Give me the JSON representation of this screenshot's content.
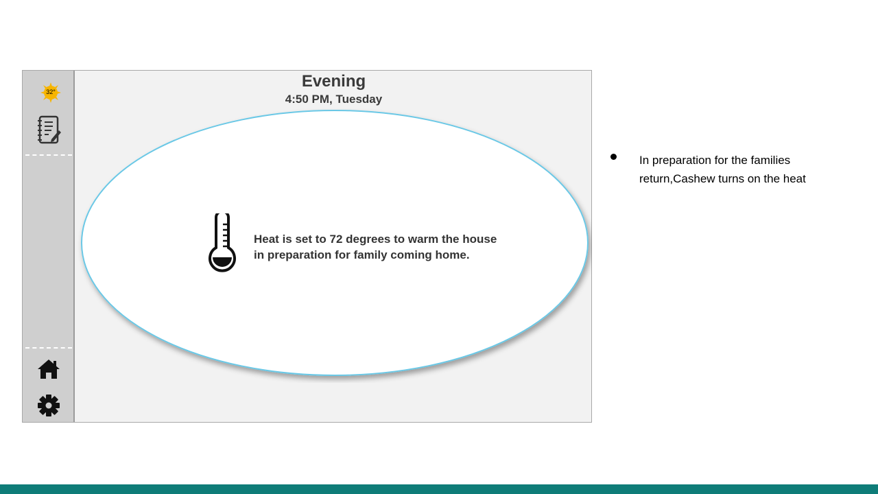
{
  "sidebar": {
    "weather": {
      "temperature": "32°",
      "icon": "sun-icon",
      "color": "#f7b500"
    },
    "items": [
      {
        "name": "notes",
        "icon": "notebook-icon"
      },
      {
        "name": "home",
        "icon": "home-icon"
      },
      {
        "name": "settings",
        "icon": "gear-icon"
      }
    ]
  },
  "header": {
    "period": "Evening",
    "datetime": "4:50 PM, Tuesday"
  },
  "notification": {
    "icon": "thermometer-icon",
    "line1": "Heat is set to 72 degrees to warm the house",
    "line2": "in preparation for family coming home."
  },
  "slide": {
    "bullet_line1": "In preparation for the families",
    "bullet_line2": "return,Cashew turns on the heat",
    "accent_color": "#0e7c78"
  }
}
